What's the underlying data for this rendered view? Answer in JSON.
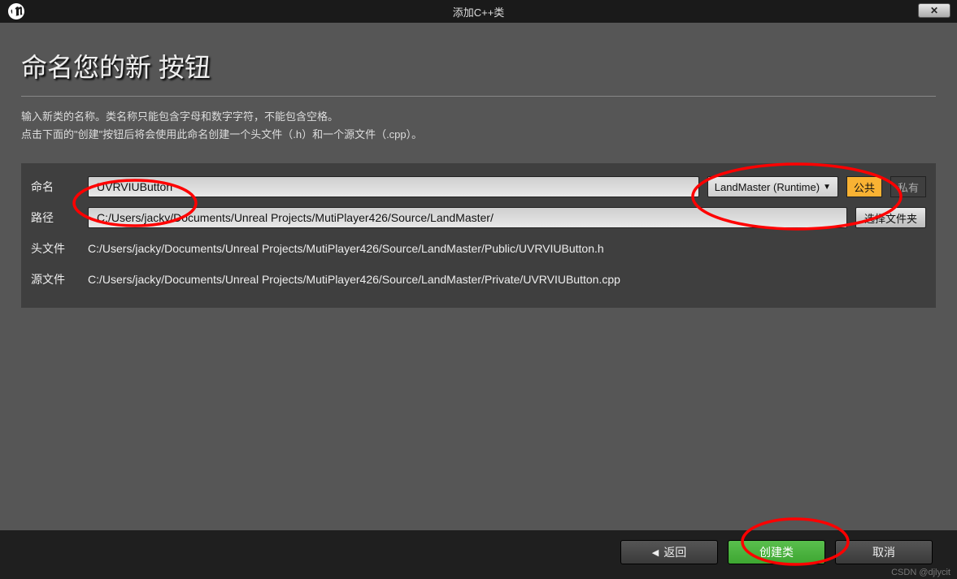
{
  "window": {
    "title": "添加C++类"
  },
  "heading": "命名您的新 按钮",
  "description": {
    "line1": "输入新类的名称。类名称只能包含字母和数字字符，不能包含空格。",
    "line2": "点击下面的\"创建\"按钮后将会使用此命名创建一个头文件（.h）和一个源文件（.cpp）。"
  },
  "labels": {
    "name": "命名",
    "path": "路径",
    "header_file": "头文件",
    "source_file": "源文件"
  },
  "fields": {
    "class_name": "UVRVIUButton",
    "module": "LandMaster (Runtime)",
    "visibility_public": "公共",
    "visibility_private": "私有",
    "path_value": "C:/Users/jacky/Documents/Unreal Projects/MutiPlayer426/Source/LandMaster/",
    "browse_label": "选择文件夹",
    "header_path": "C:/Users/jacky/Documents/Unreal Projects/MutiPlayer426/Source/LandMaster/Public/UVRVIUButton.h",
    "source_path": "C:/Users/jacky/Documents/Unreal Projects/MutiPlayer426/Source/LandMaster/Private/UVRVIUButton.cpp"
  },
  "buttons": {
    "back": "返回",
    "create": "创建类",
    "cancel": "取消"
  },
  "watermark": "CSDN @djlycit"
}
